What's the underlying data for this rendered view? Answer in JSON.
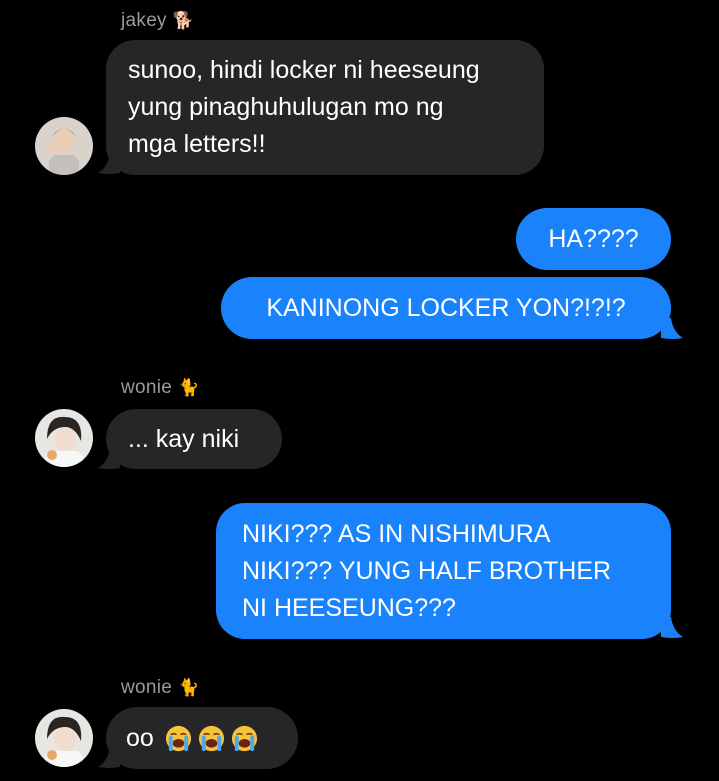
{
  "conversation": {
    "messages": [
      {
        "sender": "jakey",
        "sender_emoji": "🐕",
        "text": "sunoo, hindi locker ni heeseung\nyung pinaghuhulugan mo ng\nmga letters!!"
      },
      {
        "sender": "me",
        "text": "HA????"
      },
      {
        "sender": "me",
        "text": "KANINONG LOCKER YON?!?!?"
      },
      {
        "sender": "wonie",
        "sender_emoji": "🐈",
        "text": "... kay niki"
      },
      {
        "sender": "me",
        "text": "NIKI??? AS IN NISHIMURA\nNIKI??? YUNG HALF BROTHER\nNI HEESEUNG???"
      },
      {
        "sender": "wonie",
        "sender_emoji": "🐈",
        "text": "oo",
        "emojis": [
          "loudly-crying-face",
          "loudly-crying-face",
          "loudly-crying-face"
        ]
      }
    ]
  },
  "colors": {
    "background": "#000000",
    "incoming_bubble": "#262629",
    "outgoing_bubble": "#1a82fb",
    "sender_name": "#9a9a9f"
  }
}
